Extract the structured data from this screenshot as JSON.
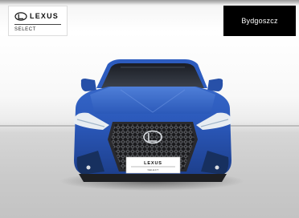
{
  "branding": {
    "logo_text": "LEXUS",
    "logo_subtitle": "SELECT"
  },
  "location": {
    "label": "Bydgoszcz"
  },
  "vehicle": {
    "plate_brand": "LEXUS",
    "plate_subtitle": "SELECT",
    "body_color": "#2a57b8"
  },
  "colors": {
    "tag_background": "#000000",
    "tag_text": "#ffffff"
  }
}
